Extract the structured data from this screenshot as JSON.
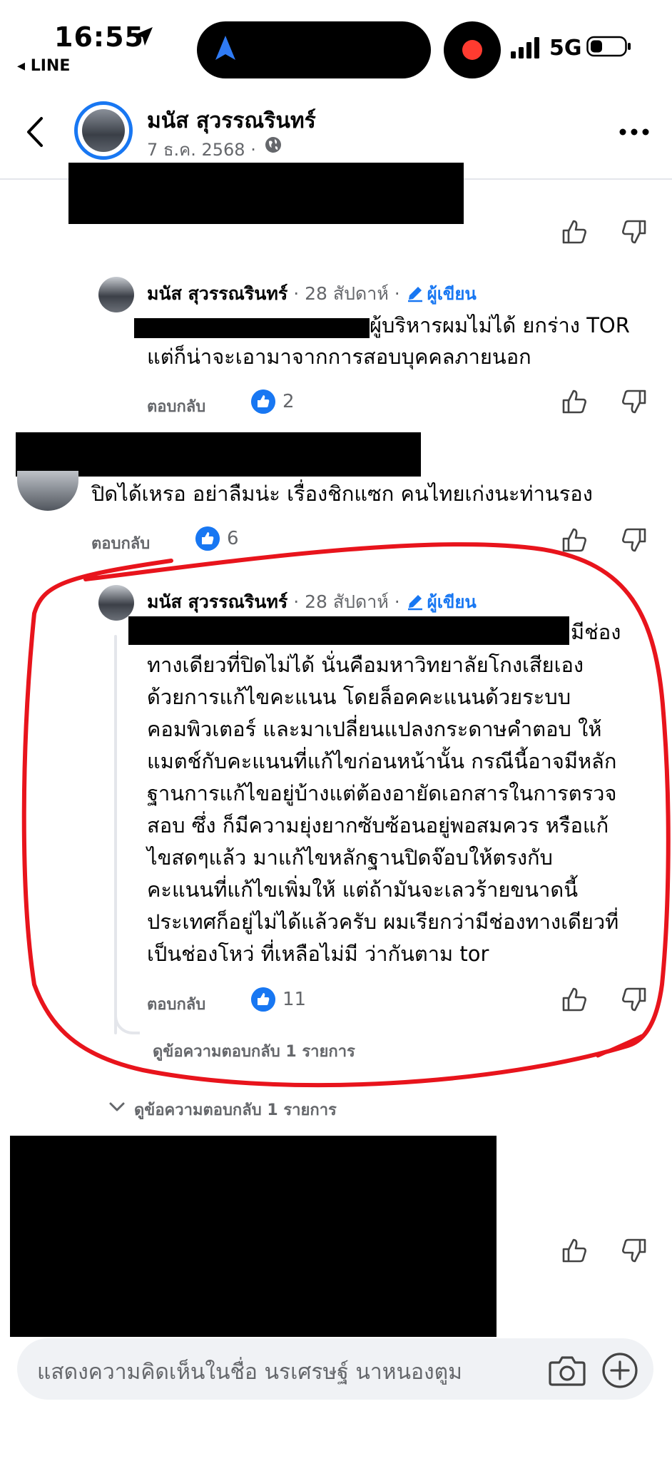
{
  "status_bar": {
    "time": "16:55",
    "back_app": "◂ LINE",
    "network": "5G"
  },
  "header": {
    "name": "มนัส สุวรรณรินทร์",
    "date": "7 ธ.ค. 2568 ·"
  },
  "comments": [
    {
      "name": "มนัส สุวรรณรินทร์",
      "meta": " · 28 สัปดาห์ · ",
      "author_badge": "ผู้เขียน",
      "line1": "ผู้บริหารผมไม่ได้ ยกร่าง TOR",
      "line2": "แต่ก็น่าจะเอามาจากการสอบบุคคลภายนอก",
      "reply": "ตอบกลับ",
      "likes": "2"
    },
    {
      "text": "ปิดได้เหรอ อย่าลืมน่ะ เรื่องชิกแซก คนไทยเก่งนะท่านรอง",
      "reply": "ตอบกลับ",
      "likes": "6"
    },
    {
      "name": "มนัส สุวรรณรินทร์",
      "meta": " · 28 สัปดาห์ · ",
      "author_badge": "ผู้เขียน",
      "first_line_tail": "มีช่อง",
      "lines": [
        "ทางเดียวที่ปิดไม่ได้ นั่นคือมหาวิทยาลัยโกงเสียเอง",
        "ด้วยการแก้ไขคะแนน โดยล็อคคะแนนด้วยระบบ",
        "คอมพิวเตอร์ และมาเปลี่ยนแปลงกระดาษคำตอบ ให้",
        "แมตช์กับคะแนนที่แก้ไขก่อนหน้านั้น กรณีนี้อาจมีหลัก",
        "ฐานการแก้ไขอยู่บ้างแต่ต้องอายัดเอกสารในการตรวจ",
        "สอบ ซึ่ง ก็มีความยุ่งยากซับซ้อนอยู่พอสมควร  หรือแก้",
        "ไขสดๆแล้ว มาแก้ไขหลักฐานปิดจ๊อบให้ตรงกับ",
        "คะแนนที่แก้ไขเพิ่มให้ แต่ถ้ามันจะเลวร้ายขนาดนี้",
        "ประเทศก็อยู่ไม่ได้แล้วครับ  ผมเรียกว่ามีช่องทางเดียวที่",
        "เป็นช่องโหว่ ที่เหลือไม่มี ว่ากันตาม tor"
      ],
      "reply": "ตอบกลับ",
      "likes": "11",
      "view_replies": "ดูข้อความตอบกลับ 1 รายการ"
    }
  ],
  "outer_view_replies": "ดูข้อความตอบกลับ 1 รายการ",
  "composer": {
    "placeholder": "แสดงความคิดเห็นในชื่อ นรเศรษฐ์ นาหนองตูม"
  },
  "colors": {
    "accent": "#1877f2",
    "annotation": "#e8141c",
    "muted": "#65676b"
  }
}
